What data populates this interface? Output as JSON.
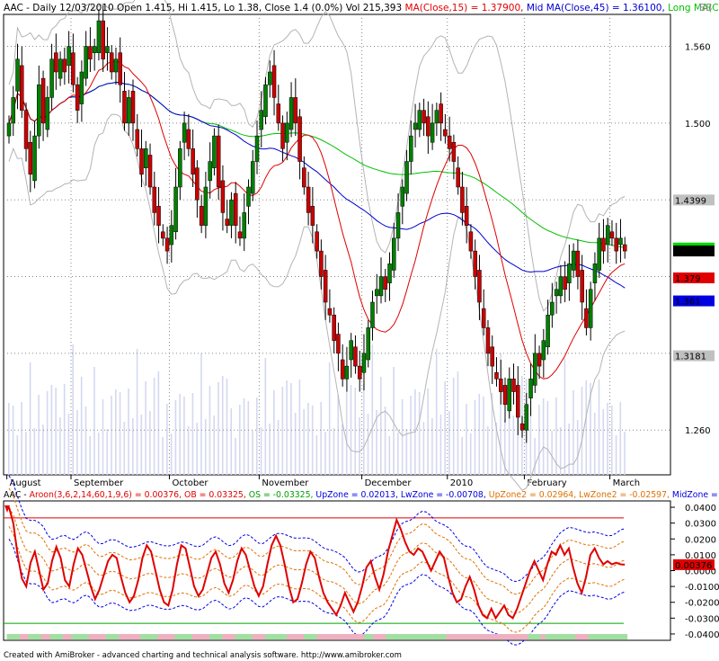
{
  "chart_data": [
    {
      "type": "candlestick",
      "ticker": "AAC",
      "header": {
        "prefix": "AAC - Daily 12/03/2010 Open 1.415, Hi 1.415, Lo 1.38, Close 1.4 (0.0%) Vol 215,393",
        "ma15": "MA(Close,15) = 1.37900,",
        "ma45": "Mid MA(Close,45) = 1.36100,",
        "ma100": "Long MA(Close,100) = 1.40235,",
        "bb": "BB"
      },
      "ylim": [
        1.225,
        1.585
      ],
      "yticks": [
        "1.560",
        "1.500",
        "1.440",
        "1.380",
        "1.320",
        "1.260"
      ],
      "x_months": [
        "August",
        "September",
        "October",
        "November",
        "December",
        "2010",
        "February",
        "March"
      ],
      "month_start_index": [
        0,
        15,
        38,
        59,
        83,
        103,
        121,
        141
      ],
      "badges": [
        {
          "value": 1.4399,
          "text": "1.4399",
          "bg": "#c0c0c0",
          "fg": "#000000"
        },
        {
          "value": 1.40235,
          "text": "1.40235",
          "bg": "#00d800",
          "fg": "#000000"
        },
        {
          "value": 1.4,
          "text": "1.4",
          "bg": "#000000",
          "fg": "#ffffff"
        },
        {
          "value": 1.379,
          "text": "1.379",
          "bg": "#e00000",
          "fg": "#000000"
        },
        {
          "value": 1.361,
          "text": "1.361",
          "bg": "#0000e0",
          "fg": "#ffffff"
        },
        {
          "value": 1.3181,
          "text": "1.3181",
          "bg": "#c0c0c0",
          "fg": "#000000"
        }
      ],
      "closes": [
        1.5,
        1.52,
        1.55,
        1.51,
        1.48,
        1.46,
        1.49,
        1.53,
        1.5,
        1.52,
        1.55,
        1.54,
        1.55,
        1.54,
        1.56,
        1.53,
        1.51,
        1.54,
        1.56,
        1.55,
        1.56,
        1.58,
        1.55,
        1.56,
        1.54,
        1.55,
        1.53,
        1.5,
        1.52,
        1.5,
        1.48,
        1.46,
        1.48,
        1.45,
        1.43,
        1.42,
        1.41,
        1.4,
        1.42,
        1.45,
        1.48,
        1.5,
        1.48,
        1.46,
        1.44,
        1.42,
        1.45,
        1.47,
        1.49,
        1.45,
        1.43,
        1.42,
        1.44,
        1.42,
        1.41,
        1.43,
        1.45,
        1.47,
        1.49,
        1.51,
        1.53,
        1.54,
        1.52,
        1.5,
        1.48,
        1.5,
        1.52,
        1.5,
        1.47,
        1.45,
        1.43,
        1.42,
        1.4,
        1.38,
        1.36,
        1.35,
        1.33,
        1.32,
        1.3,
        1.31,
        1.33,
        1.31,
        1.3,
        1.32,
        1.34,
        1.36,
        1.37,
        1.38,
        1.37,
        1.39,
        1.41,
        1.43,
        1.45,
        1.47,
        1.49,
        1.5,
        1.51,
        1.5,
        1.49,
        1.5,
        1.51,
        1.5,
        1.49,
        1.48,
        1.47,
        1.45,
        1.43,
        1.42,
        1.4,
        1.38,
        1.36,
        1.34,
        1.32,
        1.31,
        1.3,
        1.29,
        1.28,
        1.3,
        1.29,
        1.27,
        1.26,
        1.28,
        1.3,
        1.32,
        1.31,
        1.33,
        1.35,
        1.36,
        1.37,
        1.38,
        1.37,
        1.39,
        1.4,
        1.38,
        1.36,
        1.34,
        1.37,
        1.39,
        1.41,
        1.4,
        1.42,
        1.41,
        1.4,
        1.41,
        1.4
      ],
      "volume_note": "volume bars shown faintly in background",
      "colors": {
        "up": "#008000",
        "down": "#cc0000",
        "ma15": "#e00000",
        "ma45": "#0000d0",
        "ma100": "#00c000",
        "bb": "#b4b4b4",
        "vol": "#d4d8f0"
      }
    },
    {
      "type": "line",
      "title_parts": {
        "prefix": "AAC -",
        "aroon": "Aroon(3,6,2,14,60,1,9,6) = 0.00376,",
        "ob": "OB = 0.03325,",
        "os": "OS = -0.03325,",
        "upzone": "UpZone = 0.02013,",
        "lwzone": "LwZone = -0.00708,",
        "upzone2": "UpZone2 = 0.02964,",
        "lwzone2": "LwZone2 = -0.02597,",
        "midzone": "MidZone = 0.00652"
      },
      "ylim": [
        -0.044,
        0.044
      ],
      "yticks": [
        "0.0400",
        "0.0300",
        "0.0200",
        "0.0100",
        "0.0000",
        "-0.0100",
        "-0.0200",
        "-0.0300",
        "-0.0400"
      ],
      "badge": {
        "value": 0.00376,
        "text": "0.00376",
        "bg": "#e00000",
        "fg": "#000000"
      },
      "ob_level": 0.03325,
      "os_level": -0.03325,
      "series_aroon": [
        0.04,
        0.03,
        0.01,
        -0.005,
        -0.01,
        0.005,
        0.012,
        0.0,
        -0.012,
        -0.008,
        0.006,
        0.015,
        0.008,
        -0.006,
        -0.01,
        0.004,
        0.014,
        0.01,
        0.0,
        -0.01,
        -0.018,
        -0.012,
        -0.003,
        0.006,
        0.01,
        0.008,
        -0.004,
        -0.014,
        -0.02,
        -0.016,
        -0.006,
        0.008,
        0.016,
        0.012,
        0.0,
        -0.012,
        -0.02,
        -0.022,
        -0.012,
        0.004,
        0.016,
        0.014,
        0.002,
        -0.01,
        -0.016,
        -0.012,
        -0.002,
        0.008,
        0.012,
        0.004,
        -0.008,
        -0.014,
        -0.006,
        0.006,
        0.014,
        0.01,
        0.0,
        -0.01,
        -0.016,
        -0.01,
        0.004,
        0.016,
        0.022,
        0.016,
        0.004,
        -0.01,
        -0.02,
        -0.018,
        -0.008,
        0.004,
        0.012,
        0.008,
        -0.004,
        -0.014,
        -0.02,
        -0.024,
        -0.028,
        -0.022,
        -0.014,
        -0.02,
        -0.026,
        -0.02,
        -0.01,
        0.002,
        0.006,
        -0.004,
        -0.012,
        -0.002,
        0.012,
        0.022,
        0.032,
        0.026,
        0.018,
        0.012,
        0.01,
        0.014,
        0.012,
        0.006,
        0.0,
        0.006,
        0.012,
        0.008,
        -0.004,
        -0.014,
        -0.02,
        -0.018,
        -0.01,
        -0.004,
        -0.012,
        -0.022,
        -0.028,
        -0.03,
        -0.024,
        -0.03,
        -0.026,
        -0.022,
        -0.028,
        -0.03,
        -0.024,
        -0.016,
        -0.008,
        0.0,
        0.006,
        0.0,
        -0.006,
        0.004,
        0.012,
        0.01,
        0.016,
        0.01,
        0.014,
        0.002,
        -0.008,
        -0.014,
        -0.004,
        0.01,
        0.014,
        0.008,
        0.004,
        0.006,
        0.004,
        0.005,
        0.004,
        0.00376
      ],
      "colors": {
        "aroon": "#e00000",
        "obos": "#e00000",
        "upzone": "#0000e0",
        "upzone2": "#e07000",
        "midzone": "#e07000",
        "ob_text": "#e00000",
        "os_text": "#00a000"
      }
    }
  ],
  "footer": {
    "text": "Created with AmiBroker - advanced charting and technical analysis software. http://www.amibroker.com"
  }
}
